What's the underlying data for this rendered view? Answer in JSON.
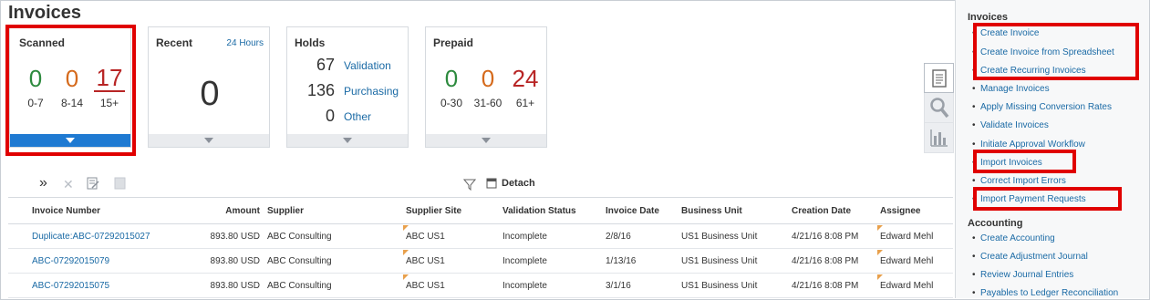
{
  "page": {
    "title": "Invoices"
  },
  "tiles": {
    "scanned": {
      "title": "Scanned",
      "counts": [
        "0",
        "0",
        "17"
      ],
      "ranges": [
        "0-7",
        "8-14",
        "15+"
      ]
    },
    "recent": {
      "title": "Recent",
      "link": "24 Hours",
      "count": "0"
    },
    "holds": {
      "title": "Holds",
      "rows": [
        {
          "count": "67",
          "label": "Validation"
        },
        {
          "count": "136",
          "label": "Purchasing"
        },
        {
          "count": "0",
          "label": "Other"
        }
      ]
    },
    "prepaid": {
      "title": "Prepaid",
      "counts": [
        "0",
        "0",
        "24"
      ],
      "ranges": [
        "0-30",
        "31-60",
        "61+"
      ]
    }
  },
  "toolbar": {
    "detach": "Detach"
  },
  "table": {
    "headers": [
      "Invoice Number",
      "Amount",
      "Supplier",
      "Supplier Site",
      "Validation Status",
      "Invoice Date",
      "Business Unit",
      "Creation Date",
      "Assignee"
    ],
    "rows": [
      [
        "Duplicate:ABC-07292015027",
        "893.80 USD",
        "ABC Consulting",
        "ABC US1",
        "Incomplete",
        "2/8/16",
        "US1 Business Unit",
        "4/21/16 8:08 PM",
        "Edward Mehl"
      ],
      [
        "ABC-07292015079",
        "893.80 USD",
        "ABC Consulting",
        "ABC US1",
        "Incomplete",
        "1/13/16",
        "US1 Business Unit",
        "4/21/16 8:08 PM",
        "Edward Mehl"
      ],
      [
        "ABC-07292015075",
        "893.80 USD",
        "ABC Consulting",
        "ABC US1",
        "Incomplete",
        "3/1/16",
        "US1 Business Unit",
        "4/21/16 8:08 PM",
        "Edward Mehl"
      ]
    ]
  },
  "panel": {
    "invoices_heading": "Invoices",
    "invoice_tasks": [
      "Create Invoice",
      "Create Invoice from Spreadsheet",
      "Create Recurring Invoices",
      "Manage Invoices",
      "Apply Missing Conversion Rates",
      "Validate Invoices",
      "Initiate Approval Workflow",
      "Import Invoices",
      "Correct Import Errors",
      "Import Payment Requests"
    ],
    "accounting_heading": "Accounting",
    "accounting_tasks": [
      "Create Accounting",
      "Create Adjustment Journal",
      "Review Journal Entries",
      "Payables to Ledger Reconciliation"
    ]
  }
}
